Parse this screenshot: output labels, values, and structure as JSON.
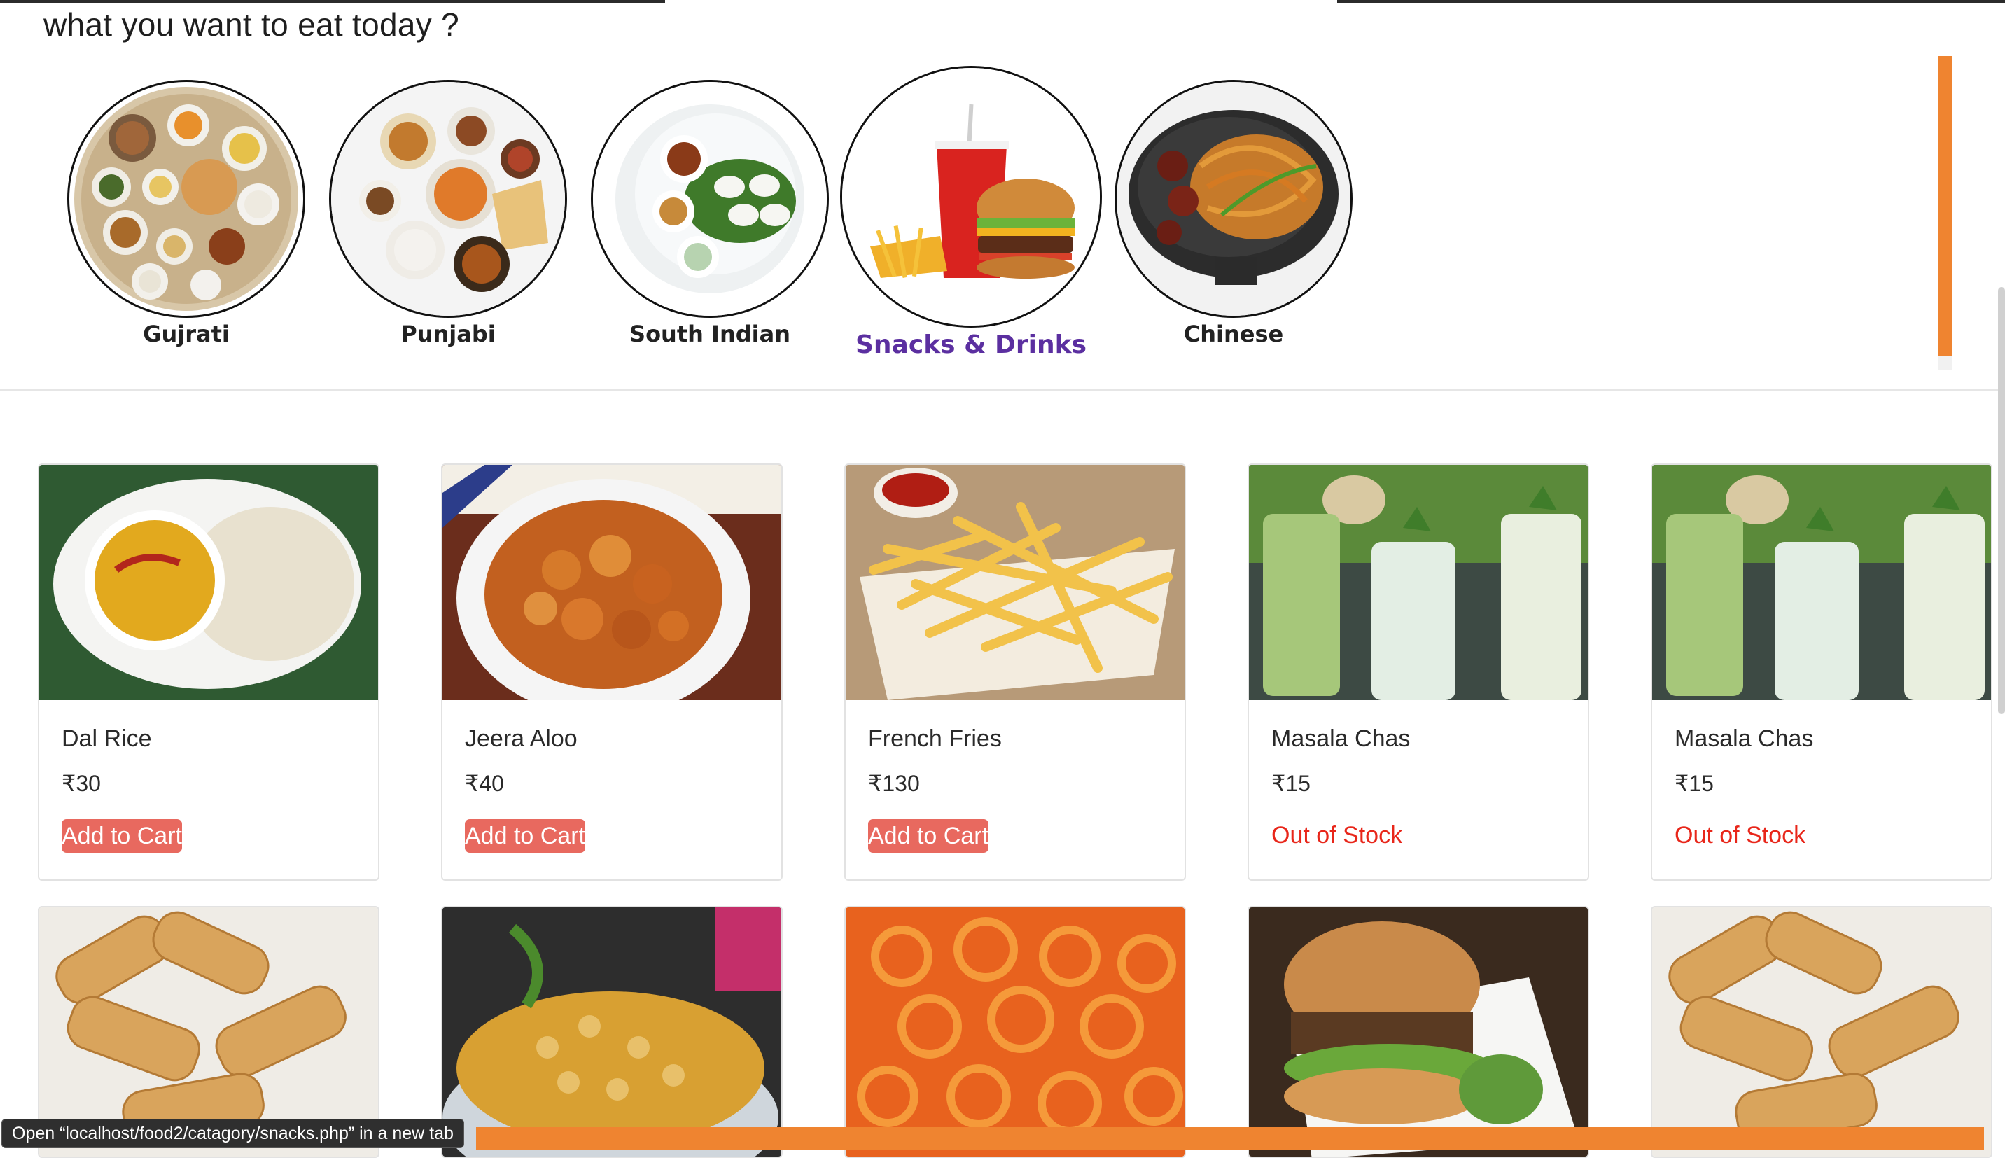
{
  "heading": "what you want to eat today ?",
  "categories": [
    {
      "label": "Gujrati",
      "icon": "thali-plate-icon"
    },
    {
      "label": "Punjabi",
      "icon": "punjabi-thali-icon"
    },
    {
      "label": "South Indian",
      "icon": "idli-sambar-icon"
    },
    {
      "label": "Snacks & Drinks",
      "icon": "burger-drink-icon"
    },
    {
      "label": "Chinese",
      "icon": "noodles-bowl-icon"
    }
  ],
  "products": [
    {
      "name": "Dal Rice",
      "price": "₹30",
      "action": "Add to Cart",
      "in_stock": true
    },
    {
      "name": "Jeera Aloo",
      "price": "₹40",
      "action": "Add to Cart",
      "in_stock": true
    },
    {
      "name": "French Fries",
      "price": "₹130",
      "action": "Add to Cart",
      "in_stock": true
    },
    {
      "name": "Masala Chas",
      "price": "₹15",
      "action": "Out of Stock",
      "in_stock": false
    },
    {
      "name": "Masala Chas",
      "price": "₹15",
      "action": "Out of Stock",
      "in_stock": false
    }
  ],
  "status_link": "Open “localhost/food2/catagory/snacks.php” in a new tab",
  "colors": {
    "accent_orange": "#ef8430",
    "button_red": "#e8695f",
    "out_of_stock_red": "#e8261a",
    "active_category_purple": "#5b2fa0"
  }
}
